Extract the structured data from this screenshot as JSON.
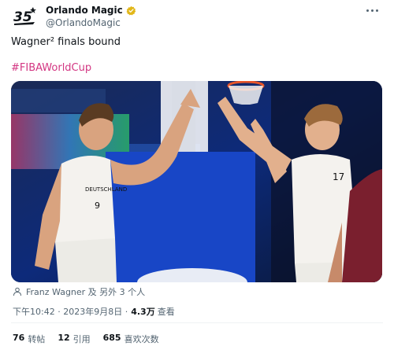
{
  "account": {
    "display_name": "Orlando Magic",
    "handle": "@OrlandoMagic",
    "avatar_text": "35",
    "verified": true
  },
  "tweet": {
    "text": "Wagner² finals bound",
    "hashtag": "#FIBAWorldCup"
  },
  "media": {
    "left_player_jersey": "9",
    "right_player_jersey": "17",
    "jersey_team": "DEUTSCHLAND"
  },
  "tagged": {
    "text": "Franz Wagner 及 另外 3 个人"
  },
  "meta": {
    "time": "下午10:42",
    "date": "2023年9月8日",
    "views_count": "4.3万",
    "views_label": "查看"
  },
  "stats": {
    "retweets_count": "76",
    "retweets_label": "转帖",
    "quotes_count": "12",
    "quotes_label": "引用",
    "likes_count": "685",
    "likes_label": "喜欢次数"
  },
  "colors": {
    "hashtag": "#d33682",
    "verified": "#e2b719",
    "secondary_text": "#536471"
  }
}
